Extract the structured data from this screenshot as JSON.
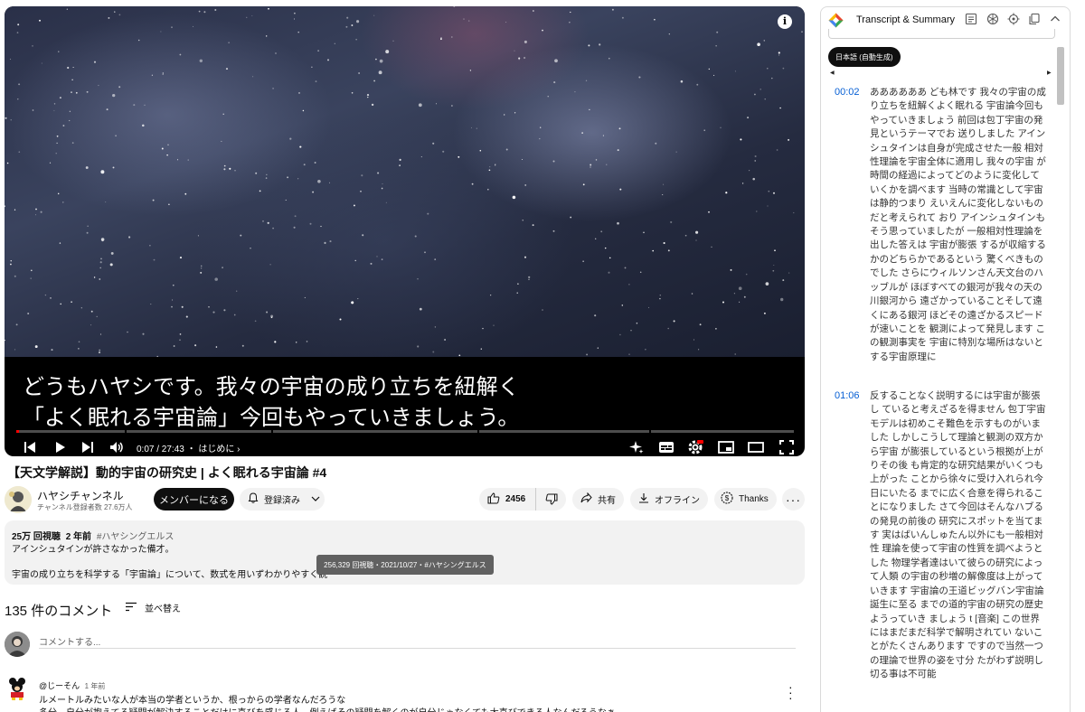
{
  "player": {
    "caption_line1": "どうもハヤシです。我々の宇宙の成り立ちを紐解く",
    "caption_line2": "「よく眠れる宇宙論」今回もやっていきましょう。",
    "time": "0:07 / 27:43",
    "chapter": "・ はじめに",
    "progress_fraction": 0.004,
    "info_icon": "i"
  },
  "video": {
    "title": "【天文学解説】動的宇宙の研究史 | よく眠れる宇宙論 #4",
    "channel_name": "ハヤシチャンネル",
    "channel_subs": "チャンネル登録者数 27.6万人",
    "join_label": "メンバーになる",
    "subscribed_label": "登録済み",
    "likes": "2456",
    "share_label": "共有",
    "offline_label": "オフライン",
    "thanks_label": "Thanks"
  },
  "description": {
    "views": "25万 回視聴",
    "age": "2 年前",
    "hashtag": "#ハヤシングエルス",
    "line1": "アインシュタインが許さなかった備才。",
    "line2": "宇宙の成り立ちを科学する「宇宙論」について、数式を用いずわかりやすく説",
    "tooltip": "256,329 回視聴・2021/10/27・#ハヤシングエルス"
  },
  "comments": {
    "count_label": "135 件のコメント",
    "sort_label": "並べ替え",
    "add_placeholder": "コメントする...",
    "items": [
      {
        "author": "@じーそん",
        "time": "1 年前",
        "line1": "ルメートルみたいな人が本当の学者というか、根っからの学者なんだろうな",
        "line2": "多分、自分が抱えてる疑問が解決することだけに喜びを感じる人。例えばその疑問を解くのが自分じゃなくても大喜びできる人なんだろうなぁ"
      }
    ]
  },
  "panel": {
    "title": "Transcript & Summary",
    "language_chip": "日本語 (自動生成)",
    "segments": [
      {
        "time": "00:02",
        "text": "ああああああ ども林です 我々の宇宙の成り立ちを紐解くよく眠れる 宇宙論今回もやっていきましょう 前回は包丁宇宙の発見というテーマでお 送りしました アインシュタインは自身が完成させた一般 相対性理論を宇宙全体に適用し 我々の宇宙 が時間の経過によってどのように変化して いくかを調べます 当時の常識として宇宙は静的つまり えいえんに変化しないものだと考えられて おり アインシュタインもそう思っていましたが 一般相対性理論を出した答えは 宇宙が膨張 するが収縮するかのどちらかであるという 驚くべきものでした さらにウィルソンさん天文台のハッブルが ほぼすべての銀河が我々の天の川銀河から 遠ざかっていることそして遠くにある銀河 ほどその遠ざかるスピードが速いことを 観測によって発見します この観測事実を 宇宙に特別な場所はないとする宇宙原理に"
      },
      {
        "time": "01:06",
        "text": "反することなく説明するには宇宙が膨張し ていると考えざるを得ません 包丁宇宙モデルは初めこそ難色を示すものがいました しかしこうして理論と観測の双方から宇宙 が膨張しているという根拠が上がりその後 も肯定的な研究結果がいくつも上がった ことから徐々に受け入れられ今日にいたる までに広く合意を得られることになりました さて今回はそんなハブるの発見の前後の 研究にスポットを当てます 実はばいんしゅたん以外にも一般相対性 理論を使って宇宙の性質を調べようとした 物理学者達はいて彼らの研究によって人類 の宇宙の秒増の解像度は上がっていきます 宇宙論の王道ビッグバン宇宙論誕生に至る までの道的宇宙の研究の歴史ようっていき ましょう t [音楽] この世界にはまだまだ科学で解明されてい ないことがたくさんあります ですので当然一つの理論で世界の姿を寸分 たがわず説明し切る事は不可能"
      }
    ]
  }
}
